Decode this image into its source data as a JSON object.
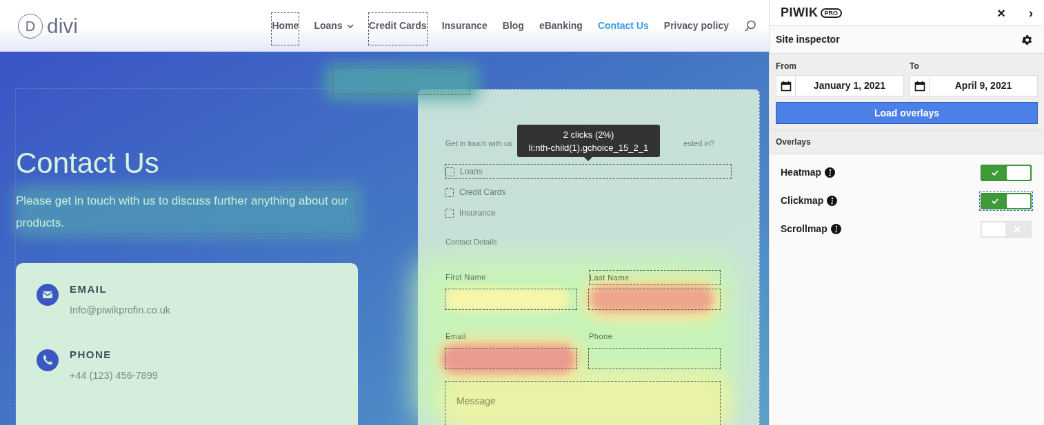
{
  "site": {
    "logo_letter": "D",
    "logo_text": "divi",
    "nav": [
      {
        "label": "Home",
        "selected": false,
        "outlined": true,
        "dropdown": false
      },
      {
        "label": "Loans",
        "selected": false,
        "outlined": false,
        "dropdown": true
      },
      {
        "label": "Credit Cards",
        "selected": false,
        "outlined": true,
        "dropdown": false
      },
      {
        "label": "Insurance",
        "selected": false,
        "outlined": false,
        "dropdown": false
      },
      {
        "label": "Blog",
        "selected": false,
        "outlined": false,
        "dropdown": false
      },
      {
        "label": "eBanking",
        "selected": false,
        "outlined": false,
        "dropdown": false
      },
      {
        "label": "Contact Us",
        "selected": true,
        "outlined": false,
        "dropdown": false
      },
      {
        "label": "Privacy policy",
        "selected": false,
        "outlined": false,
        "dropdown": false
      }
    ],
    "heading": "Contact Us",
    "intro": "Please get in touch with us to discuss further anything about our products.",
    "contacts": [
      {
        "kind": "email",
        "title": "EMAIL",
        "value": "Info@piwikprofin.co.uk"
      },
      {
        "kind": "phone",
        "title": "PHONE",
        "value": "+44 (123) 456-7899"
      }
    ],
    "form": {
      "question_start": "Get in touch with us",
      "question_end": "ested in?",
      "choices": [
        {
          "label": "Loans",
          "outlined": true
        },
        {
          "label": "Credit Cards",
          "outlined": false
        },
        {
          "label": "Insurance",
          "outlined": false
        }
      ],
      "section": "Contact Details",
      "fields": [
        {
          "label": "First Name",
          "label_outlined": false
        },
        {
          "label": "Last Name",
          "label_outlined": true
        },
        {
          "label": "Email",
          "label_outlined": false
        },
        {
          "label": "Phone",
          "label_outlined": false
        }
      ],
      "message": {
        "placeholder": "Message"
      }
    },
    "tooltip": {
      "line_1": "2 clicks (2%)",
      "line_2": "li:nth-child(1).gchoice_15_2_1"
    }
  },
  "panel": {
    "logo": "PIWIK",
    "logo_badge": "PRO",
    "close": "×",
    "collapse": "›",
    "title": "Site inspector",
    "from": {
      "label": "From",
      "value": "January 1, 2021"
    },
    "to": {
      "label": "To",
      "value": "April 9, 2021"
    },
    "button": "Load overlays",
    "section": "Overlays",
    "overlays": [
      {
        "label": "Heatmap",
        "on": true,
        "focused": false
      },
      {
        "label": "Clickmap",
        "on": true,
        "focused": true
      },
      {
        "label": "Scrollmap",
        "on": false,
        "focused": false
      }
    ]
  }
}
